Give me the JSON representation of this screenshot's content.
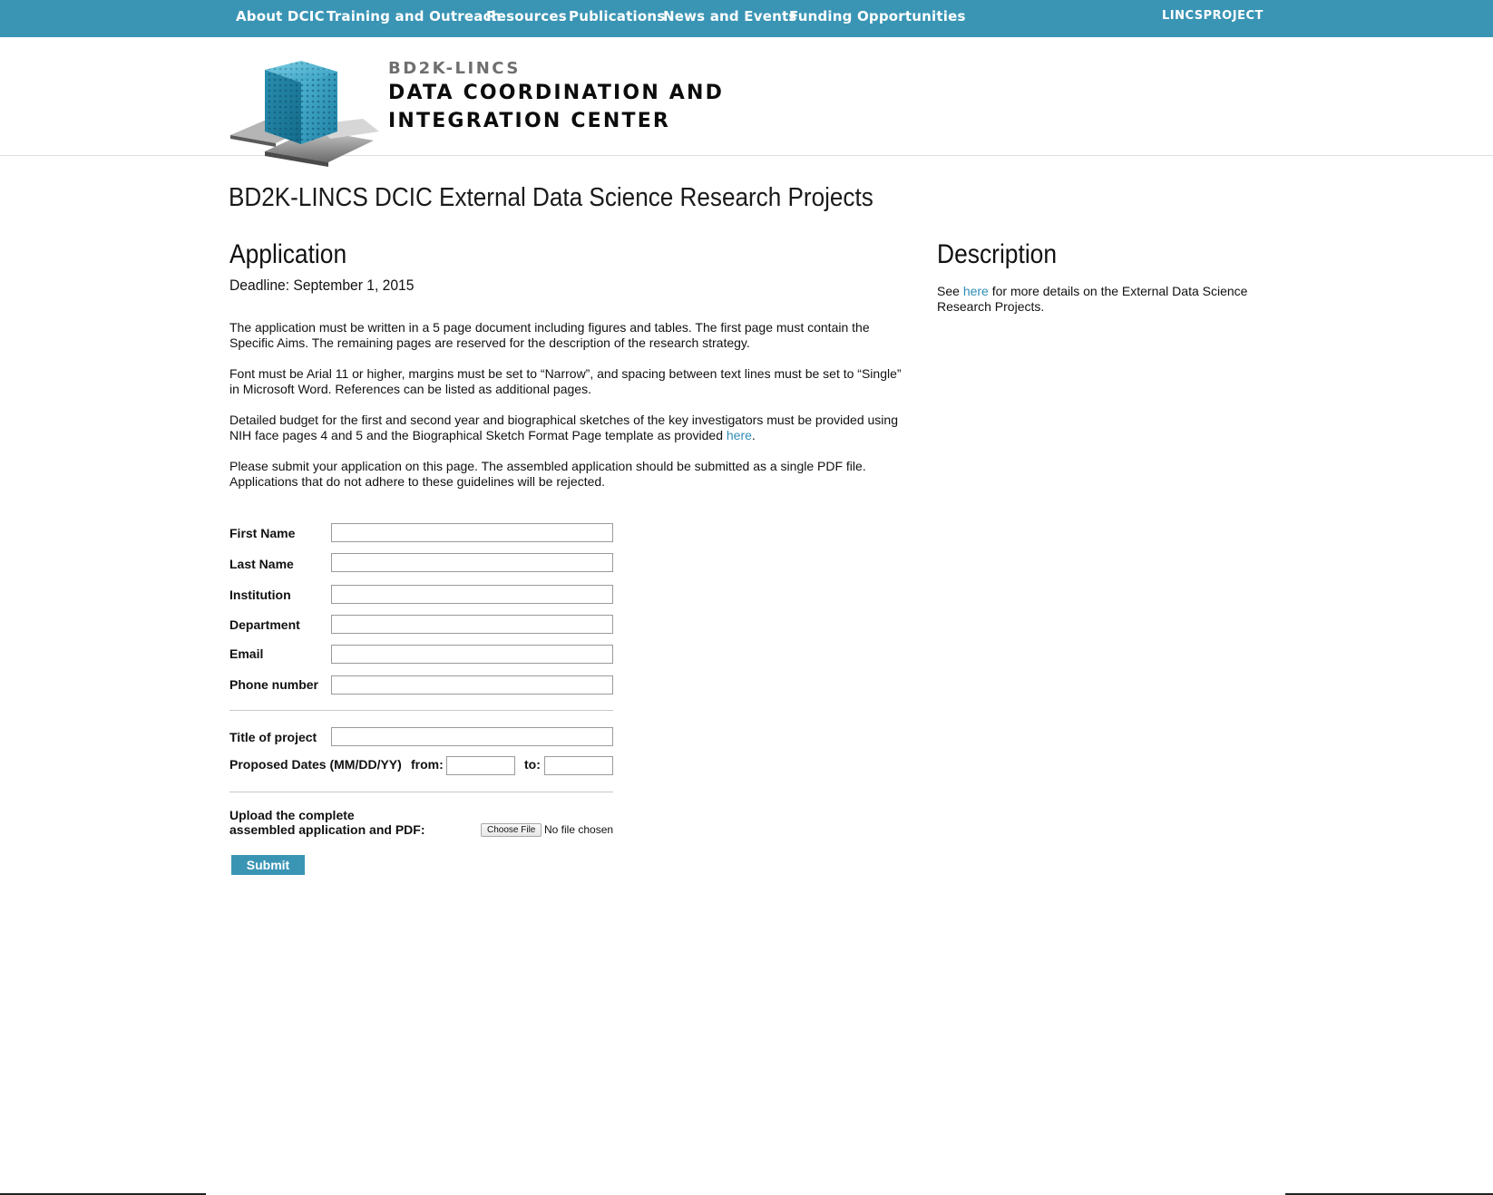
{
  "nav": {
    "items": [
      "About DCIC",
      "Training and Outreach",
      "Resources",
      "Publications",
      "News and Events",
      "Funding Opportunities"
    ],
    "right_link": "LINCSPROJECT"
  },
  "brand": {
    "small": "BD2K-LINCS",
    "line1": "DATA COORDINATION AND",
    "line2": "INTEGRATION CENTER"
  },
  "page": {
    "title": "BD2K-LINCS DCIC External Data Science Research Projects"
  },
  "application": {
    "heading": "Application",
    "deadline": "Deadline: September 1, 2015",
    "para1": "The application must be written in a 5 page document including figures and tables. The first page must contain the Specific Aims. The remaining pages are reserved for the description of the research strategy.",
    "para2": "Font must be Arial 11 or higher, margins must be set to “Narrow”, and spacing between text lines must be set to “Single” in Microsoft Word. References can be listed as additional pages.",
    "para3_before": "Detailed budget for the first and second year and biographical sketches of the key investigators must be provided using NIH face pages 4 and 5 and the Biographical Sketch Format Page template as provided ",
    "para3_link": "here",
    "para3_after": ".",
    "para4": "Please submit your application on this page. The assembled application should be submitted as a single PDF file. Applications that do not adhere to these guidelines will be rejected."
  },
  "description": {
    "heading": "Description",
    "before": "See ",
    "link": "here",
    "after": " for more details on the External Data Science Research Projects."
  },
  "form": {
    "fields": [
      "First Name",
      "Last Name",
      "Institution",
      "Department",
      "Email",
      "Phone number"
    ],
    "title_label": "Title of project",
    "dates_label": "Proposed Dates (MM/DD/YY)",
    "from_label": "from:",
    "to_label": "to:",
    "upload_label_1": "Upload the complete",
    "upload_label_2": "assembled application and PDF:",
    "choose_file": "Choose File",
    "no_file": "No file chosen",
    "submit": "Submit"
  },
  "colors": {
    "accent": "#3a95b5",
    "link": "#2f8db5"
  }
}
